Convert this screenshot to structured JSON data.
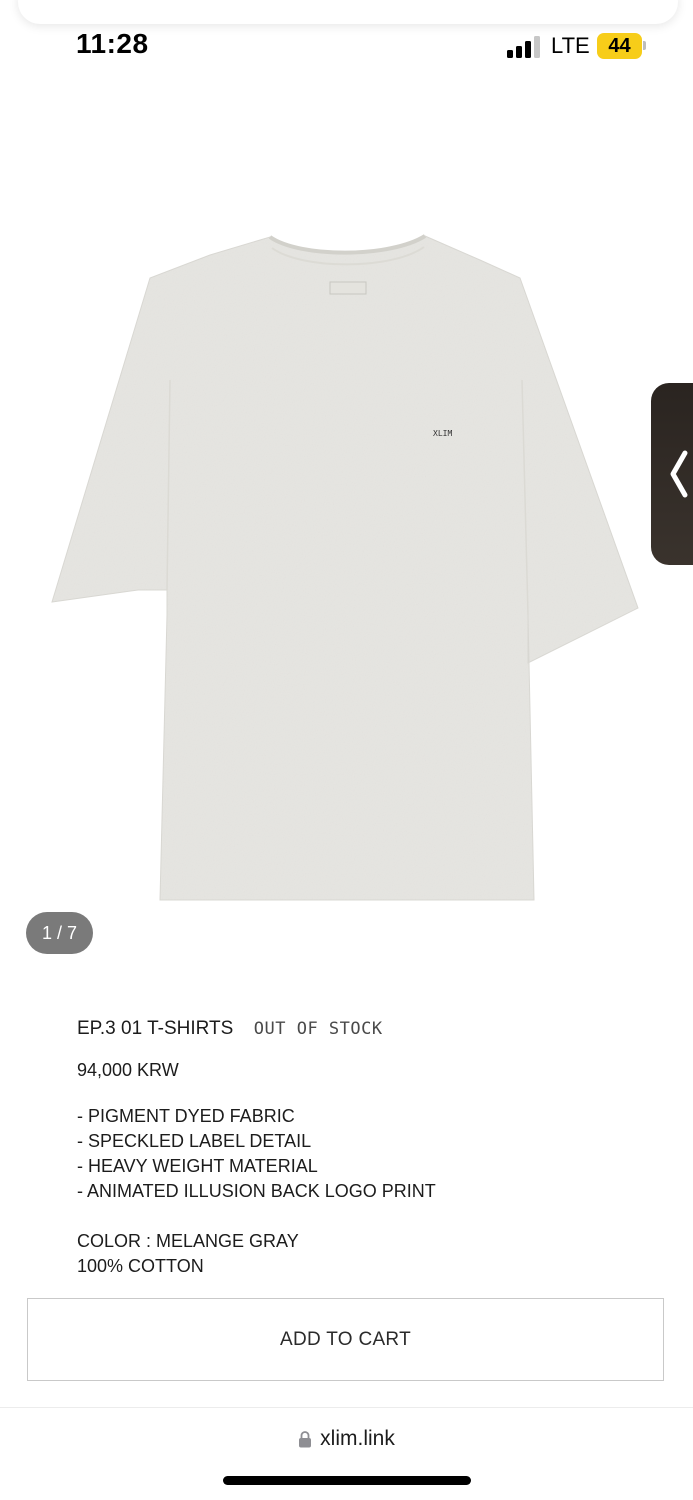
{
  "status_bar": {
    "time": "11:28",
    "network": "LTE",
    "battery": "44",
    "battery_color": "#f7cd19"
  },
  "gallery": {
    "counter": "1 / 7",
    "image_alt": "EP.3 01 T-SHIRTS",
    "shirt_label_text": "XLIM",
    "shirt_color": "#e6e5e1"
  },
  "product": {
    "title": "EP.3 01 T-SHIRTS",
    "stock_status": "OUT OF STOCK",
    "price": "94,000 KRW",
    "features": [
      "- PIGMENT DYED FABRIC",
      "- SPECKLED LABEL DETAIL",
      "- HEAVY WEIGHT MATERIAL",
      "- ANIMATED ILLUSION BACK LOGO PRINT"
    ],
    "color_line": "COLOR : MELANGE GRAY",
    "material_line": "100% COTTON"
  },
  "actions": {
    "add_to_cart_label": "ADD TO CART"
  },
  "browser": {
    "url": "xlim.link"
  }
}
